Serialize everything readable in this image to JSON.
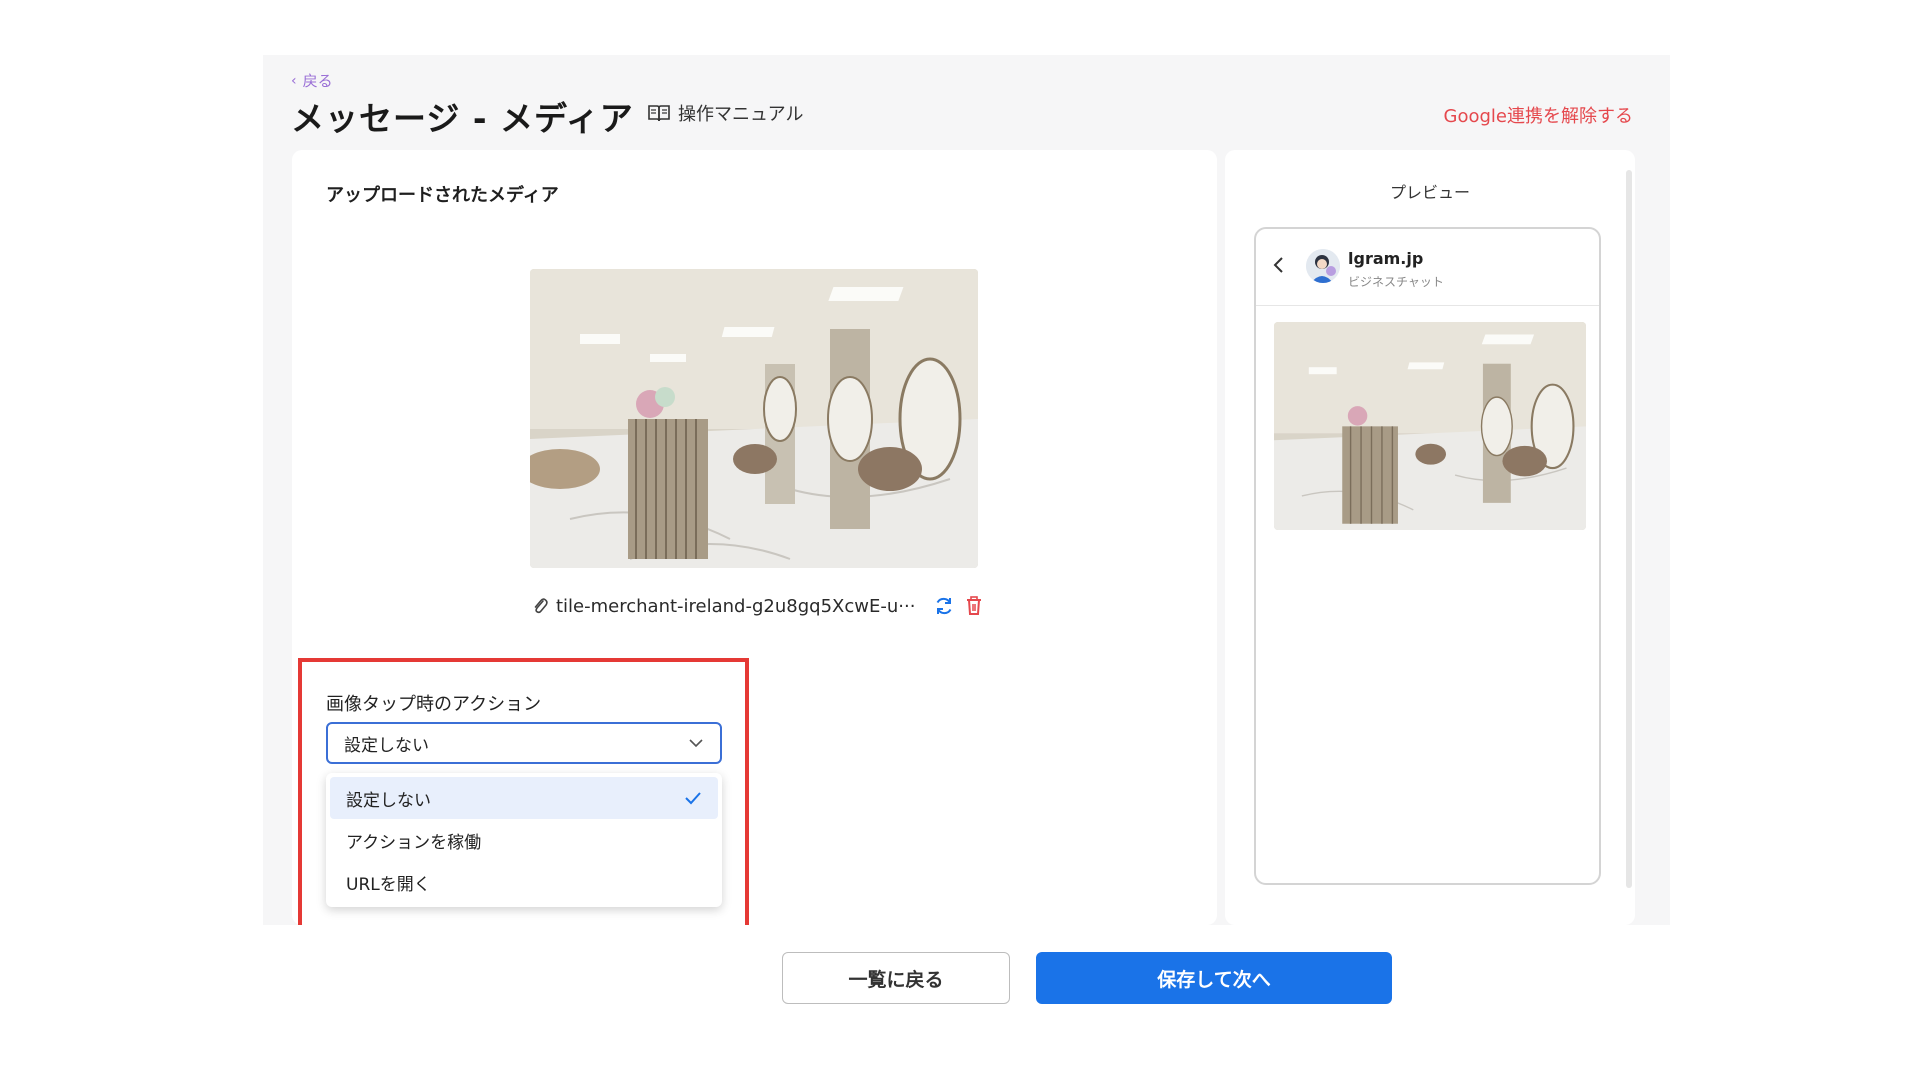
{
  "header": {
    "back_label": "戻る",
    "title": "メッセージ - メディア",
    "manual_label": "操作マニュアル",
    "unlink_label": "Google連携を解除する"
  },
  "media": {
    "section_title": "アップロードされたメディア",
    "file_name": "tile-merchant-ireland-g2u8gq5XcwE-u···",
    "image_alt": "salon interior photo"
  },
  "action": {
    "label": "画像タップ時のアクション",
    "selected_value": "設定しない",
    "options": [
      "設定しない",
      "アクションを稼働",
      "URLを開く"
    ]
  },
  "preview": {
    "title": "プレビュー",
    "account_name": "lgram.jp",
    "account_sub": "ビジネスチャット"
  },
  "footer": {
    "back_button": "一覧に戻る",
    "save_button": "保存して次へ"
  },
  "colors": {
    "accent_blue": "#1a73e8",
    "danger_red": "#e5484d",
    "highlight_red": "#e53935",
    "back_link_purple": "#9a6fd6"
  }
}
